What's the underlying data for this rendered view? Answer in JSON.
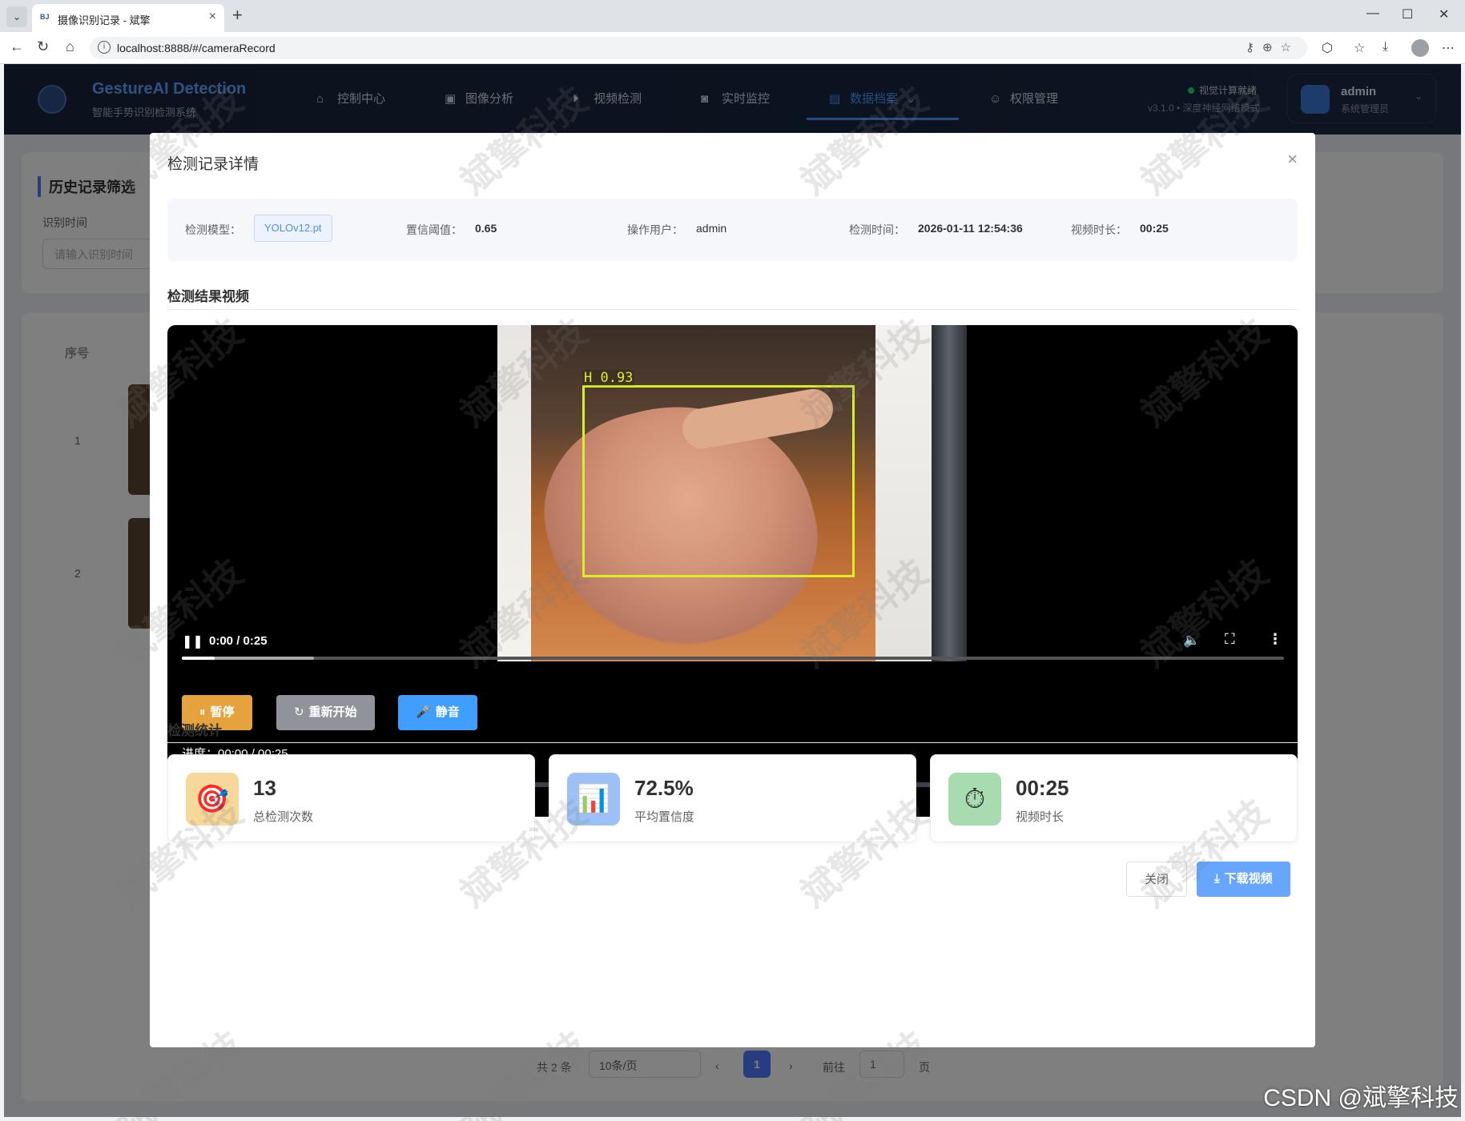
{
  "browser": {
    "tab_favicon": "BJ",
    "tab_title": "摄像识别记录 - 斌擎",
    "tab_close": "×",
    "new_tab": "+",
    "url": "localhost:8888/#/cameraRecord",
    "window_min": "—",
    "window_max": "☐",
    "window_close": "✕"
  },
  "app": {
    "brand_title": "GestureAI Detection",
    "brand_sub": "智能手势识别检测系统",
    "nav": [
      {
        "label": "控制中心",
        "icon": "home-icon"
      },
      {
        "label": "图像分析",
        "icon": "image-icon"
      },
      {
        "label": "视频检测",
        "icon": "play-circle-icon"
      },
      {
        "label": "实时监控",
        "icon": "camera-icon"
      },
      {
        "label": "数据档案",
        "icon": "document-icon",
        "active": true
      },
      {
        "label": "权限管理",
        "icon": "user-icon"
      }
    ],
    "status": "视觉计算就绪",
    "version": "v3.1.0 • 深度神经网络模式",
    "user_name": "admin",
    "user_role": "系统管理员"
  },
  "background": {
    "filter_title": "历史记录筛选",
    "filter_label": "识别时间",
    "filter_placeholder": "请输入识别时间",
    "col_index": "序号",
    "rows": [
      "1",
      "2"
    ],
    "total": "共 2 条",
    "page_size": "10条/页",
    "current_page": "1",
    "goto_label": "前往",
    "goto_value": "1",
    "page_suffix": "页"
  },
  "dialog": {
    "title": "检测记录详情",
    "close_icon": "×",
    "info": {
      "model_label": "检测模型：",
      "model_value": "YOLOv12.pt",
      "threshold_label": "置信阈值：",
      "threshold_value": "0.65",
      "user_label": "操作用户：",
      "user_value": "admin",
      "time_label": "检测时间：",
      "time_value": "2026-01-11 12:54:36",
      "duration_label": "视频时长：",
      "duration_value": "00:25"
    },
    "video_section_title": "检测结果视频",
    "video": {
      "detection_label": "H 0.93",
      "time_display": "0:00 / 0:25",
      "buffered_fraction": 0.12,
      "played_fraction": 0.03,
      "pause_label": "暂停",
      "restart_label": "重新开始",
      "mute_label": "静音",
      "progress_text": "进度：00:00 / 00:25",
      "slider_fraction": 0.026
    },
    "stats_section_title": "检测统计",
    "stats": [
      {
        "value": "13",
        "label": "总检测次数",
        "icon": "target-icon",
        "color": "#f5c86a"
      },
      {
        "value": "72.5%",
        "label": "平均置信度",
        "icon": "bar-chart-icon",
        "color": "#6ea3f5"
      },
      {
        "value": "00:25",
        "label": "视频时长",
        "icon": "stopwatch-icon",
        "color": "#7dc98a"
      }
    ],
    "close_button": "关闭",
    "download_button": "下载视频"
  },
  "watermark_text": "斌擎科技",
  "csdn_mark": "CSDN @斌擎科技"
}
